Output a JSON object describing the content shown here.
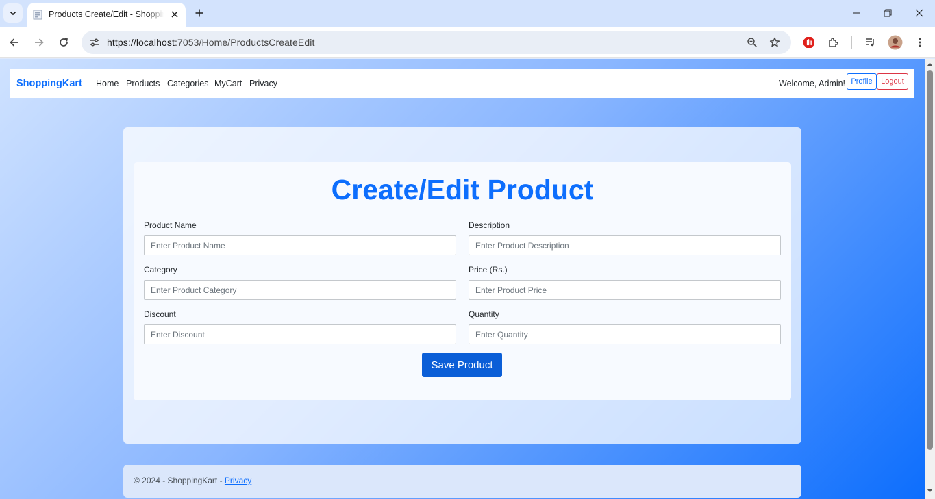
{
  "browser": {
    "tab_title": "Products Create/Edit - ShoppingKart",
    "url": "https://localhost:7053/Home/ProductsCreateEdit",
    "url_host": "https://localhost",
    "url_rest": ":7053/Home/ProductsCreateEdit"
  },
  "nav": {
    "brand": "ShoppingKart",
    "links": [
      "Home",
      "Products",
      "Categories",
      "MyCart",
      "Privacy"
    ],
    "welcome": "Welcome, Admin!",
    "profile_label": "Profile",
    "logout_label": "Logout"
  },
  "form": {
    "title": "Create/Edit Product",
    "fields": [
      {
        "label": "Product Name",
        "placeholder": "Enter Product Name",
        "value": ""
      },
      {
        "label": "Description",
        "placeholder": "Enter Product Description",
        "value": ""
      },
      {
        "label": "Category",
        "placeholder": "Enter Product Category",
        "value": ""
      },
      {
        "label": "Price (Rs.)",
        "placeholder": "Enter Product Price",
        "value": ""
      },
      {
        "label": "Discount",
        "placeholder": "Enter Discount",
        "value": ""
      },
      {
        "label": "Quantity",
        "placeholder": "Enter Quantity",
        "value": ""
      }
    ],
    "save_label": "Save Product"
  },
  "footer": {
    "text": "© 2024 - ShoppingKart - ",
    "link": "Privacy"
  },
  "colors": {
    "primary": "#0d6efd",
    "danger": "#dc3545",
    "save_button": "#0b5ed7",
    "browser_frame": "#d3e3fd"
  },
  "icons": {
    "tab_list": "chevron-down-icon",
    "favicon": "page-icon",
    "tab_close": "close-icon",
    "new_tab": "plus-icon",
    "back": "arrow-left-icon",
    "forward": "arrow-right-icon",
    "reload": "reload-icon",
    "site_info": "tune-icon",
    "zoom": "zoom-icon",
    "bookmark": "star-icon",
    "adblock": "adblock-icon",
    "extensions": "puzzle-icon",
    "media": "media-icon",
    "profile": "avatar",
    "menu": "kebab-menu-icon"
  }
}
